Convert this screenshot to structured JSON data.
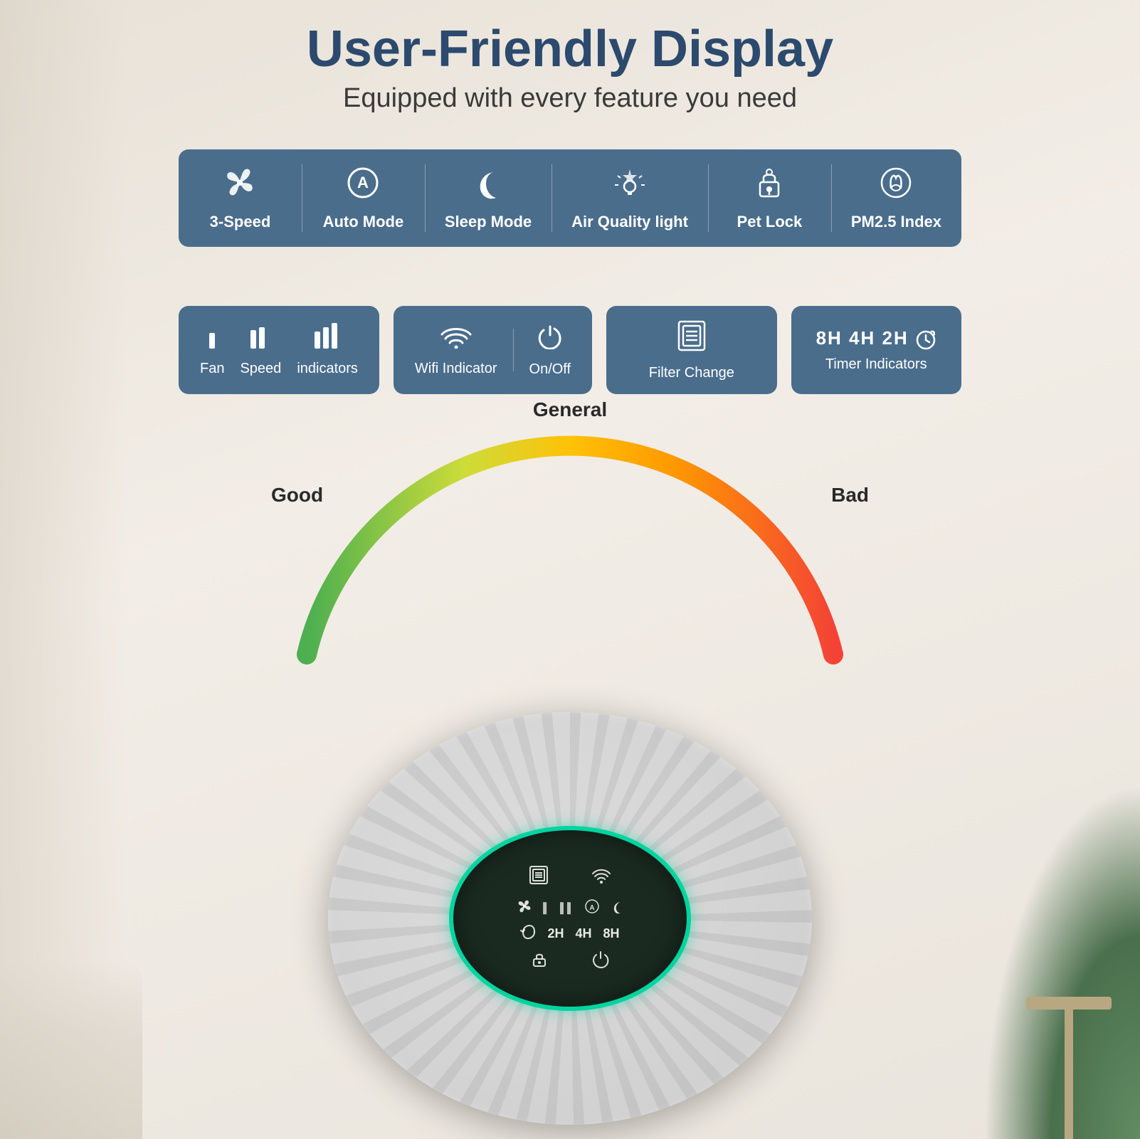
{
  "header": {
    "main_title": "User-Friendly Display",
    "subtitle": "Equipped with every feature you need"
  },
  "features_row1": {
    "items": [
      {
        "id": "three-speed",
        "icon": "❄",
        "label": "3-Speed"
      },
      {
        "id": "auto-mode",
        "icon": "Ⓐ",
        "label": "Auto Mode"
      },
      {
        "id": "sleep-mode",
        "icon": "☽",
        "label": "Sleep Mode"
      },
      {
        "id": "air-quality",
        "icon": "💡",
        "label": "Air Quality light"
      },
      {
        "id": "pet-lock",
        "icon": "🔒",
        "label": "Pet Lock"
      },
      {
        "id": "pm25",
        "icon": "🌿",
        "label": "PM2.5 Index"
      }
    ]
  },
  "features_row2": {
    "boxes": [
      {
        "id": "fan-speed",
        "items": [
          {
            "icon": "▌",
            "label": "Fan"
          },
          {
            "icon": "▌▌",
            "label": "Speed"
          },
          {
            "icon": "▌▌▌",
            "label": "indicators"
          }
        ]
      },
      {
        "id": "wifi-onoff",
        "items": [
          {
            "icon": "📶",
            "label": "Wifi Indicator"
          },
          {
            "icon": "⏻",
            "label": "On/Off"
          }
        ]
      },
      {
        "id": "filter-change",
        "items": [
          {
            "icon": "⊡",
            "label": "Filter Change"
          }
        ]
      },
      {
        "id": "timer",
        "items": [
          {
            "icon": "8H 4H 2H ⟳",
            "label": "Timer Indicators"
          }
        ]
      }
    ]
  },
  "arc": {
    "label_general": "General",
    "label_good": "Good",
    "label_bad": "Bad"
  },
  "panel": {
    "top_icons": [
      "⊡",
      "📶"
    ],
    "mid_icons": [
      "❄",
      "▌",
      "▌▌",
      "Ⓐ",
      "☽"
    ],
    "timer_labels": [
      "2H",
      "4H",
      "8H"
    ],
    "bottom_icons": [
      "⊙",
      "⏻"
    ]
  }
}
